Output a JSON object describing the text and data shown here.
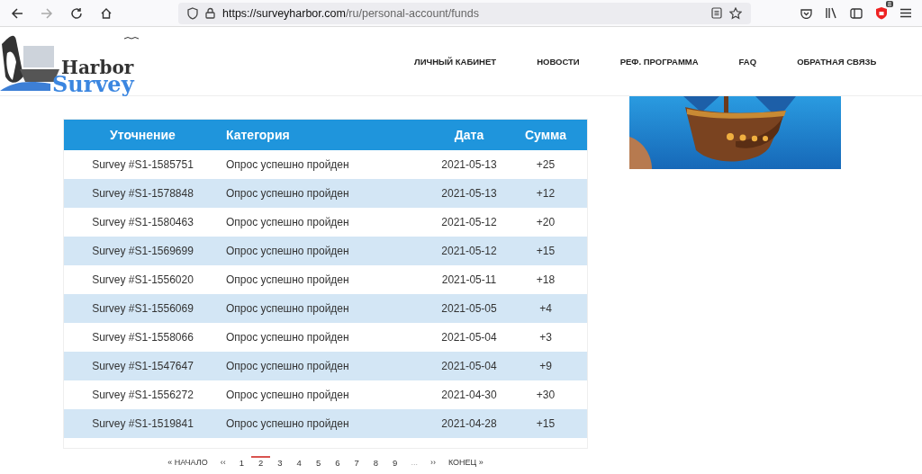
{
  "browser": {
    "url_host": "https://surveyharbor.com",
    "url_path": "/ru/personal-account/funds",
    "extension_badge": "8"
  },
  "logo": {
    "word_top": "Harbor",
    "word_bottom": "Survey"
  },
  "nav": [
    "ЛИЧНЫЙ КАБИНЕТ",
    "НОВОСТИ",
    "РЕФ. ПРОГРАММА",
    "FAQ",
    "ОБРАТНАЯ СВЯЗЬ"
  ],
  "table": {
    "columns": [
      "Уточнение",
      "Категория",
      "Дата",
      "Сумма"
    ],
    "rows": [
      [
        "Survey #S1-1585751",
        "Опрос успешно пройден",
        "2021-05-13",
        "+25"
      ],
      [
        "Survey #S1-1578848",
        "Опрос успешно пройден",
        "2021-05-13",
        "+12"
      ],
      [
        "Survey #S1-1580463",
        "Опрос успешно пройден",
        "2021-05-12",
        "+20"
      ],
      [
        "Survey #S1-1569699",
        "Опрос успешно пройден",
        "2021-05-12",
        "+15"
      ],
      [
        "Survey #S1-1556020",
        "Опрос успешно пройден",
        "2021-05-11",
        "+18"
      ],
      [
        "Survey #S1-1556069",
        "Опрос успешно пройден",
        "2021-05-05",
        "+4"
      ],
      [
        "Survey #S1-1558066",
        "Опрос успешно пройден",
        "2021-05-04",
        "+3"
      ],
      [
        "Survey #S1-1547647",
        "Опрос успешно пройден",
        "2021-05-04",
        "+9"
      ],
      [
        "Survey #S1-1556272",
        "Опрос успешно пройден",
        "2021-04-30",
        "+30"
      ],
      [
        "Survey #S1-1519841",
        "Опрос успешно пройден",
        "2021-04-28",
        "+15"
      ]
    ]
  },
  "pagination": [
    {
      "label": "« НАЧАЛО",
      "kind": "nav",
      "selected": false
    },
    {
      "label": "‹‹",
      "kind": "nav",
      "selected": false
    },
    {
      "label": "1",
      "kind": "page",
      "selected": false
    },
    {
      "label": "2",
      "kind": "page",
      "selected": true
    },
    {
      "label": "3",
      "kind": "page",
      "selected": false
    },
    {
      "label": "4",
      "kind": "page",
      "selected": false
    },
    {
      "label": "5",
      "kind": "page",
      "selected": false
    },
    {
      "label": "6",
      "kind": "page",
      "selected": false
    },
    {
      "label": "7",
      "kind": "page",
      "selected": false
    },
    {
      "label": "8",
      "kind": "page",
      "selected": false
    },
    {
      "label": "9",
      "kind": "page",
      "selected": false
    },
    {
      "label": "...",
      "kind": "gap",
      "selected": false
    },
    {
      "label": "››",
      "kind": "nav",
      "selected": false
    },
    {
      "label": "КОНЕЦ »",
      "kind": "nav",
      "selected": false
    }
  ]
}
